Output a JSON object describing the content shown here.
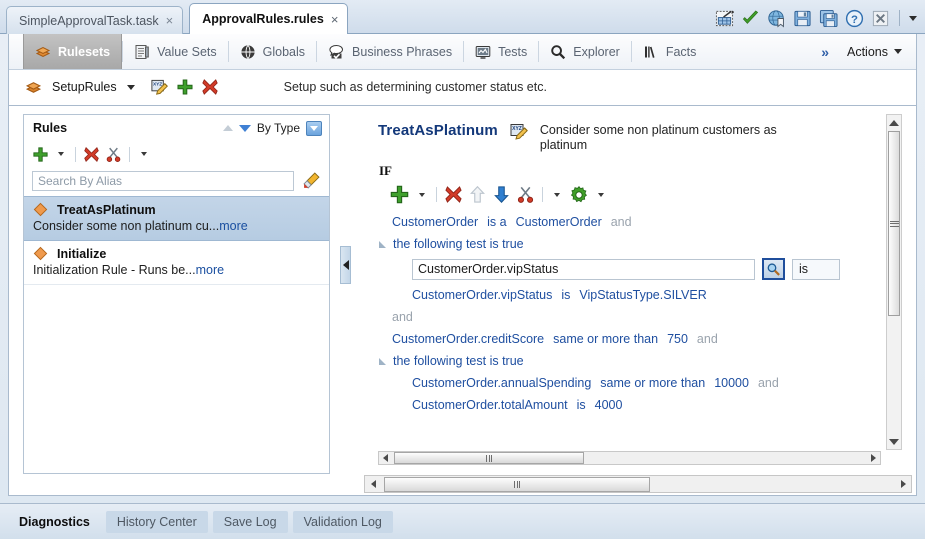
{
  "window": {
    "doc_tabs": [
      {
        "label": "SimpleApprovalTask.task",
        "close": "×",
        "active": false
      },
      {
        "label": "ApprovalRules.rules",
        "close": "×",
        "active": true
      }
    ],
    "top_icons": [
      {
        "name": "expand-table-icon",
        "title": "Expand"
      },
      {
        "name": "validate-check-icon",
        "title": "Validate"
      },
      {
        "name": "globe-bookmark-icon",
        "title": "Web"
      },
      {
        "name": "save-icon",
        "title": "Save"
      },
      {
        "name": "save-all-icon",
        "title": "Save All"
      },
      {
        "name": "help-icon",
        "title": "Help"
      },
      {
        "name": "close-icon",
        "title": "Close"
      }
    ]
  },
  "ribbon": {
    "tabs": [
      {
        "label": "Rulesets",
        "icon": "rulesets-icon",
        "active": true
      },
      {
        "label": "Value Sets",
        "icon": "value-sets-icon",
        "active": false
      },
      {
        "label": "Globals",
        "icon": "globals-icon",
        "active": false
      },
      {
        "label": "Business Phrases",
        "icon": "business-phrases-icon",
        "active": false
      },
      {
        "label": "Tests",
        "icon": "tests-icon",
        "active": false
      },
      {
        "label": "Explorer",
        "icon": "explorer-icon",
        "active": false
      },
      {
        "label": "Facts",
        "icon": "facts-icon",
        "active": false
      }
    ],
    "overflow_label": "»",
    "actions_label": "Actions"
  },
  "setup": {
    "name": "SetupRules",
    "description": "Setup such as determining customer status etc.",
    "tools": [
      {
        "name": "edit-dictionary-icon"
      },
      {
        "name": "add-icon"
      },
      {
        "name": "delete-icon"
      }
    ]
  },
  "rules_panel": {
    "title": "Rules",
    "sort_label": "By Type",
    "search_placeholder": "Search By Alias",
    "search_value": "",
    "toolbar": [
      {
        "name": "add-rule-icon"
      },
      {
        "name": "delete-rule-icon"
      },
      {
        "name": "cut-rule-icon"
      },
      {
        "name": "highlighter-icon"
      }
    ],
    "items": [
      {
        "name": "TreatAsPlatinum",
        "description": "Consider some non platinum cu...",
        "more": "more",
        "selected": true
      },
      {
        "name": "Initialize",
        "description": "Initialization Rule - Runs be...",
        "more": "more",
        "selected": false
      }
    ]
  },
  "editor": {
    "rule_title": "TreatAsPlatinum",
    "rule_subtitle": "Consider some non platinum customers as platinum",
    "if_label": "IF",
    "if_tools": [
      {
        "name": "add-condition-icon"
      },
      {
        "name": "delete-condition-icon"
      },
      {
        "name": "move-up-icon"
      },
      {
        "name": "move-down-icon"
      },
      {
        "name": "cut-condition-icon"
      },
      {
        "name": "settings-gear-icon"
      }
    ],
    "conditions": [
      {
        "kind": "simple",
        "indent": 1,
        "left": "CustomerOrder",
        "operator": "is a",
        "right": "CustomerOrder",
        "connector": "and"
      },
      {
        "kind": "group",
        "indent": 0,
        "text": "the following test is true"
      },
      {
        "kind": "editing",
        "indent": 2,
        "value": "CustomerOrder.vipStatus",
        "operator_value": "is"
      },
      {
        "kind": "simple",
        "indent": 2,
        "left": "CustomerOrder.vipStatus",
        "operator": "is",
        "right": "VipStatusType.SILVER",
        "connector": ""
      },
      {
        "kind": "connector",
        "indent": 1,
        "text": "and"
      },
      {
        "kind": "simple",
        "indent": 1,
        "left": "CustomerOrder.creditScore",
        "operator": "same or more than",
        "right": "750",
        "connector": "and"
      },
      {
        "kind": "group",
        "indent": 0,
        "text": "the following test is true"
      },
      {
        "kind": "simple",
        "indent": 2,
        "left": "CustomerOrder.annualSpending",
        "operator": "same or more than",
        "right": "10000",
        "connector": "and"
      },
      {
        "kind": "simple",
        "indent": 2,
        "left": "CustomerOrder.totalAmount",
        "operator": "is",
        "right": "4000",
        "connector": ""
      }
    ]
  },
  "bottom_tabs": [
    {
      "label": "Diagnostics",
      "active": true
    },
    {
      "label": "History Center",
      "active": false
    },
    {
      "label": "Save Log",
      "active": false
    },
    {
      "label": "Validation Log",
      "active": false
    }
  ],
  "colors": {
    "accent_blue": "#1f4fa0",
    "title_blue": "#13387a",
    "selection": "#b6cce2",
    "muted": "#9aa3ad"
  }
}
